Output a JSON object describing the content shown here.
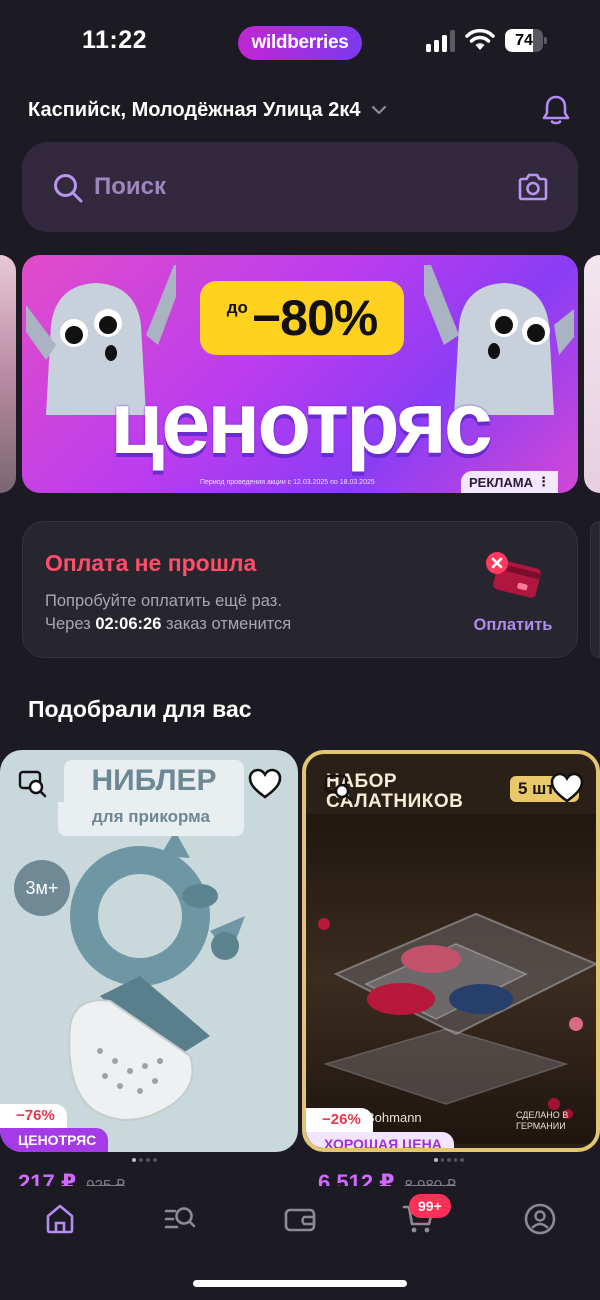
{
  "status_bar": {
    "time": "11:22",
    "brand": "wildberries",
    "battery_percent": "74",
    "battery_level": 0.74
  },
  "header": {
    "address": "Каспийск, Молодёжная Улица 2к4",
    "chevron_icon": "chevron-down-icon",
    "bell_icon": "bell-icon"
  },
  "search": {
    "placeholder": "Поиск",
    "search_icon": "search-icon",
    "camera_icon": "camera-icon"
  },
  "banner": {
    "badge_small": "до",
    "badge_big": "−80%",
    "title": "ценотряс",
    "fine_print": "Период проведения акции с 12.03.2025 по 18.03.2025",
    "ad_label": "РЕКЛАМА",
    "ad_menu": "⋮"
  },
  "payment": {
    "title": "Оплата не прошла",
    "line1": "Попробуйте оплатить ещё раз.",
    "line2_prefix": "Через",
    "timer": "02:06:26",
    "line2_suffix": "заказ отменится",
    "button": "Оплатить"
  },
  "section": {
    "title": "Подобрали для вас"
  },
  "products": [
    {
      "image_title": "НИБЛЕР",
      "image_subtitle": "для прикорма",
      "age": "3м+",
      "discount": "−76%",
      "promo": "ЦЕНОТРЯС",
      "price": "217 ₽",
      "old_price": "925 ₽"
    },
    {
      "image_title": "НАБОР САЛАТНИКОВ",
      "quantity": "5 шт",
      "brand": "Bohmann",
      "made_in": "СДЕЛАНО В ГЕРМАНИИ",
      "discount": "−26%",
      "promo": "ХОРОШАЯ ЦЕНА",
      "price": "6 512 ₽",
      "old_price": "8 980 ₽"
    }
  ],
  "tab_bar": {
    "cart_badge": "99+",
    "tabs": [
      "home-icon",
      "catalog-search-icon",
      "wallet-icon",
      "cart-icon",
      "profile-icon"
    ]
  },
  "colors": {
    "background": "#1c1a22",
    "accent": "#a53be8",
    "error": "#ff4d6a",
    "price": "#d06aff"
  }
}
